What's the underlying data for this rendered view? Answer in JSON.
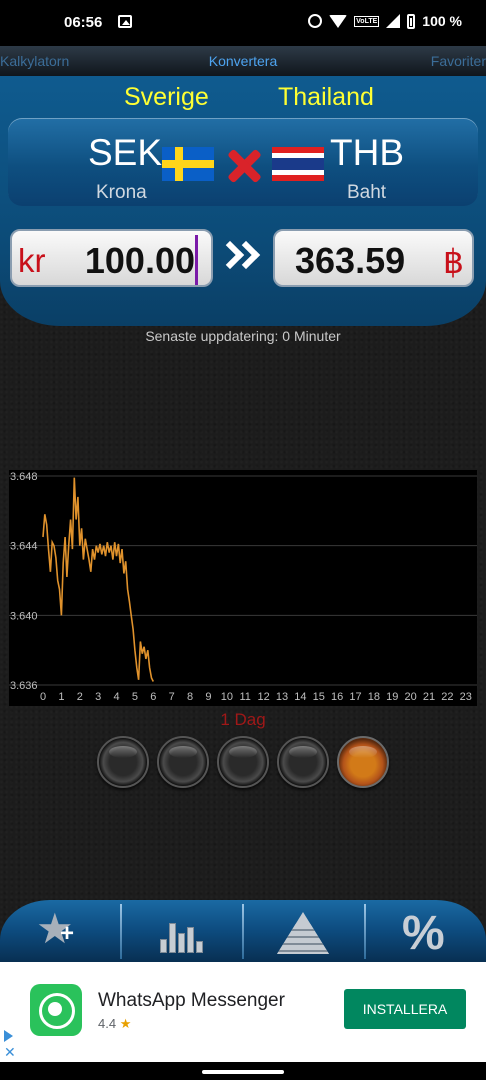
{
  "status_bar": {
    "time": "06:56",
    "battery": "100 %"
  },
  "tabs": {
    "left": "Kalkylatorn",
    "center": "Konvertera",
    "right": "Favoriter"
  },
  "from": {
    "country": "Sverige",
    "code": "SEK",
    "name": "Krona",
    "symbol": "kr",
    "amount": "100.00"
  },
  "to": {
    "country": "Thailand",
    "code": "THB",
    "name": "Baht",
    "symbol": "฿",
    "amount": "363.59"
  },
  "updated": "Senaste uppdatering: 0 Minuter",
  "period_label": "1 Dag",
  "chart_data": {
    "type": "line",
    "x_ticks": [
      "0",
      "1",
      "2",
      "3",
      "4",
      "5",
      "6",
      "7",
      "8",
      "9",
      "10",
      "11",
      "12",
      "13",
      "14",
      "15",
      "16",
      "17",
      "18",
      "19",
      "20",
      "21",
      "22",
      "23"
    ],
    "y_ticks": [
      "3.648",
      "3.644",
      "3.640",
      "3.636"
    ],
    "ylim": [
      3.636,
      3.648
    ],
    "xlim": [
      0,
      23.5
    ],
    "color": "#e0922c",
    "series": [
      {
        "x": [
          0.0,
          0.1,
          0.2,
          0.3,
          0.4,
          0.5,
          0.6,
          0.7,
          0.8,
          0.9,
          1.0,
          1.1,
          1.2,
          1.3,
          1.4,
          1.5,
          1.6,
          1.7,
          1.8,
          1.9,
          2.0,
          2.1,
          2.2,
          2.3,
          2.4,
          2.5,
          2.6,
          2.7,
          2.8,
          2.9,
          3.0,
          3.1,
          3.2,
          3.3,
          3.4,
          3.5,
          3.6,
          3.7,
          3.8,
          3.9,
          4.0,
          4.1,
          4.2,
          4.3,
          4.4,
          4.5,
          4.6,
          4.7,
          4.8,
          4.9,
          5.0,
          5.1,
          5.2,
          5.3,
          5.4,
          5.5,
          5.6,
          5.7,
          5.8,
          5.9,
          6.0
        ],
        "y": [
          3.6445,
          3.6458,
          3.6452,
          3.6438,
          3.6425,
          3.6442,
          3.644,
          3.6433,
          3.642,
          3.6415,
          3.64,
          3.643,
          3.6445,
          3.6422,
          3.644,
          3.6455,
          3.6438,
          3.6479,
          3.6455,
          3.6468,
          3.644,
          3.645,
          3.6432,
          3.6444,
          3.6438,
          3.6432,
          3.6425,
          3.6438,
          3.6432,
          3.644,
          3.6436,
          3.6441,
          3.6435,
          3.644,
          3.6434,
          3.6442,
          3.6436,
          3.644,
          3.6432,
          3.6442,
          3.6434,
          3.6441,
          3.643,
          3.6438,
          3.6424,
          3.6431,
          3.6415,
          3.6408,
          3.64,
          3.6392,
          3.638,
          3.637,
          3.6363,
          3.6385,
          3.6378,
          3.6382,
          3.6375,
          3.638,
          3.637,
          3.6364,
          3.6362
        ]
      }
    ]
  },
  "periods": [
    {
      "name": "period-1",
      "active": false
    },
    {
      "name": "period-2",
      "active": false
    },
    {
      "name": "period-3",
      "active": false
    },
    {
      "name": "period-4",
      "active": false
    },
    {
      "name": "period-1-dag",
      "active": true
    }
  ],
  "ad": {
    "title": "WhatsApp Messenger",
    "rating": "4.4",
    "button": "INSTALLERA"
  }
}
